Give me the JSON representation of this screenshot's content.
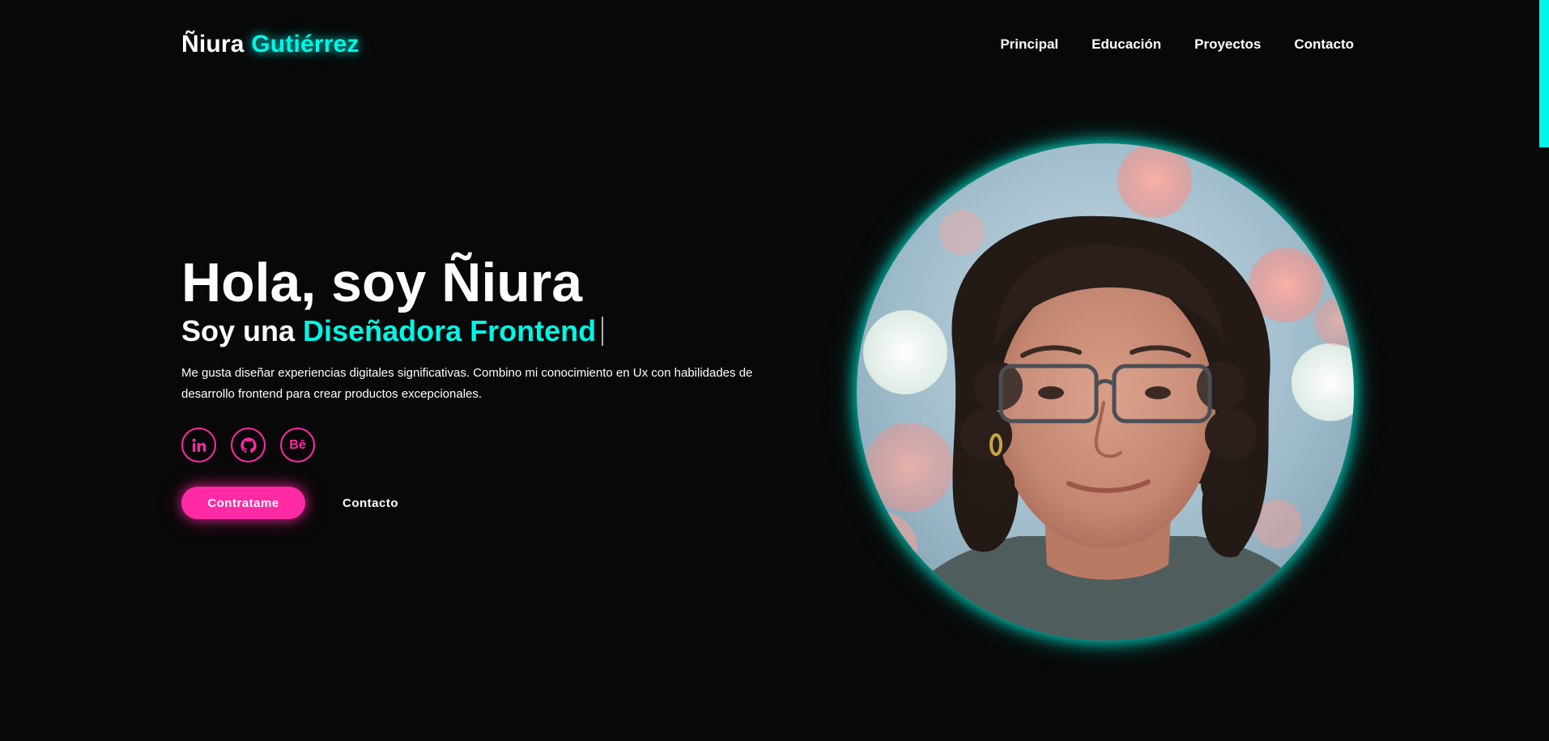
{
  "header": {
    "logo_first": "Ñiura",
    "logo_last": "Gutiérrez",
    "nav": [
      {
        "label": "Principal"
      },
      {
        "label": "Educación"
      },
      {
        "label": "Proyectos"
      },
      {
        "label": "Contacto"
      }
    ]
  },
  "hero": {
    "title": "Hola, soy Ñiura",
    "subtitle_prefix": "Soy una",
    "subtitle_highlight": "Diseñadora Frontend",
    "description": "Me gusta diseñar experiencias digitales significativas. Combino mi conocimiento en Ux con habilidades de desarrollo frontend para crear productos excepcionales.",
    "socials": [
      {
        "icon": "linkedin-icon",
        "label": "in"
      },
      {
        "icon": "github-icon"
      },
      {
        "icon": "behance-icon",
        "label": "Bē"
      }
    ],
    "primary_button": "Contratame",
    "secondary_button": "Contacto"
  },
  "colors": {
    "background": "#080808",
    "accent_cyan": "#00f6e6",
    "accent_pink": "#ff2aa4",
    "text": "#ffffff"
  }
}
